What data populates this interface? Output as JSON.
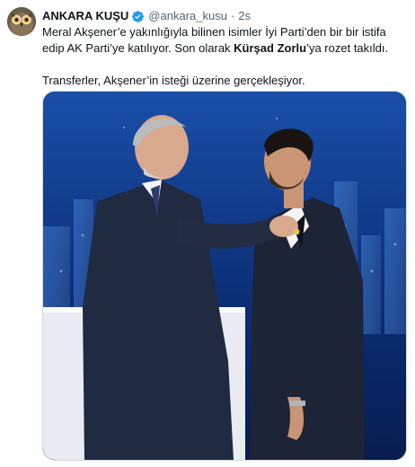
{
  "post": {
    "author": {
      "display_name": "ANKARA KUŞU",
      "handle": "@ankara_kusu",
      "verified": true,
      "avatar_icon": "owl-avatar-icon"
    },
    "separator": "·",
    "time": "2s",
    "text": {
      "part1": "Meral Akşener’e yakınlığıyla bilinen isimler İyi Parti’den bir bir istifa edip AK Parti’ye katılıyor. Son olarak ",
      "bold": "Kürşad Zorlu",
      "part2": "’ya rozet takıldı.",
      "paragraph2": "Transferler, Akşener’in isteği üzerine gerçekleşiyor."
    },
    "media": {
      "type": "photo"
    }
  },
  "colors": {
    "text_primary": "#0f1419",
    "text_secondary": "#536471",
    "verified_blue": "#1d9bf0",
    "border": "#cfd9de",
    "photo_background": "#0b2a63"
  }
}
